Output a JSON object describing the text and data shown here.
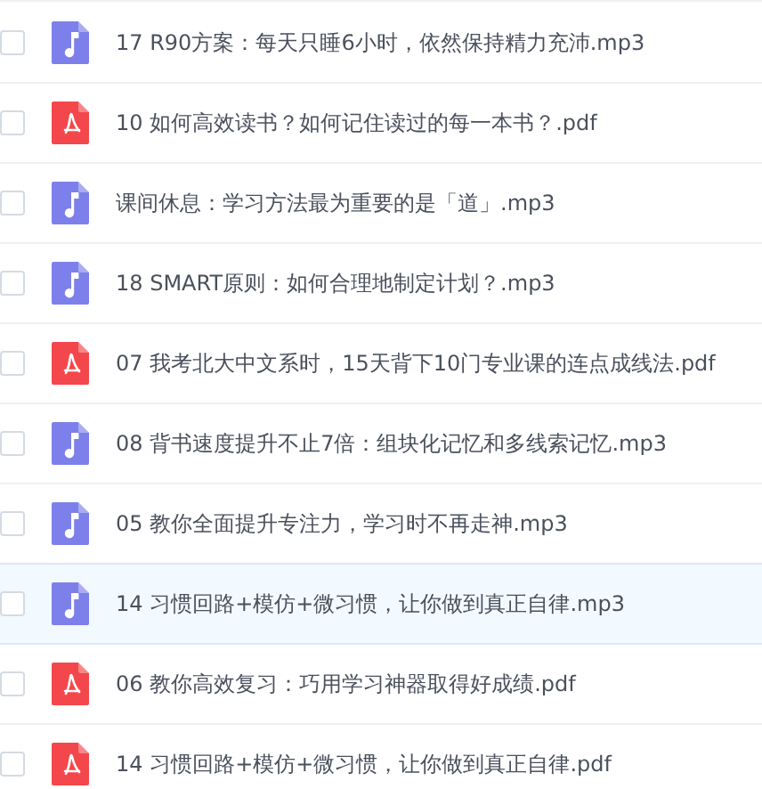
{
  "files": [
    {
      "kind": "audio",
      "name": "17 R90方案：每天只睡6小时，依然保持精力充沛.mp3",
      "checked": false,
      "highlighted": false
    },
    {
      "kind": "pdf",
      "name": "10 如何高效读书？如何记住读过的每一本书？.pdf",
      "checked": false,
      "highlighted": false
    },
    {
      "kind": "audio",
      "name": "课间休息：学习方法最为重要的是「道」.mp3",
      "checked": false,
      "highlighted": false
    },
    {
      "kind": "audio",
      "name": "18 SMART原则：如何合理地制定计划？.mp3",
      "checked": false,
      "highlighted": false
    },
    {
      "kind": "pdf",
      "name": "07 我考北大中文系时，15天背下10门专业课的连点成线法.pdf",
      "checked": false,
      "highlighted": false
    },
    {
      "kind": "audio",
      "name": "08 背书速度提升不止7倍：组块化记忆和多线索记忆.mp3",
      "checked": false,
      "highlighted": false
    },
    {
      "kind": "audio",
      "name": "05 教你全面提升专注力，学习时不再走神.mp3",
      "checked": false,
      "highlighted": false
    },
    {
      "kind": "audio",
      "name": "14 习惯回路+模仿+微习惯，让你做到真正自律.mp3",
      "checked": false,
      "highlighted": true
    },
    {
      "kind": "pdf",
      "name": "06 教你高效复习：巧用学习神器取得好成绩.pdf",
      "checked": false,
      "highlighted": false
    },
    {
      "kind": "pdf",
      "name": "14 习惯回路+模仿+微习惯，让你做到真正自律.pdf",
      "checked": false,
      "highlighted": false
    }
  ]
}
